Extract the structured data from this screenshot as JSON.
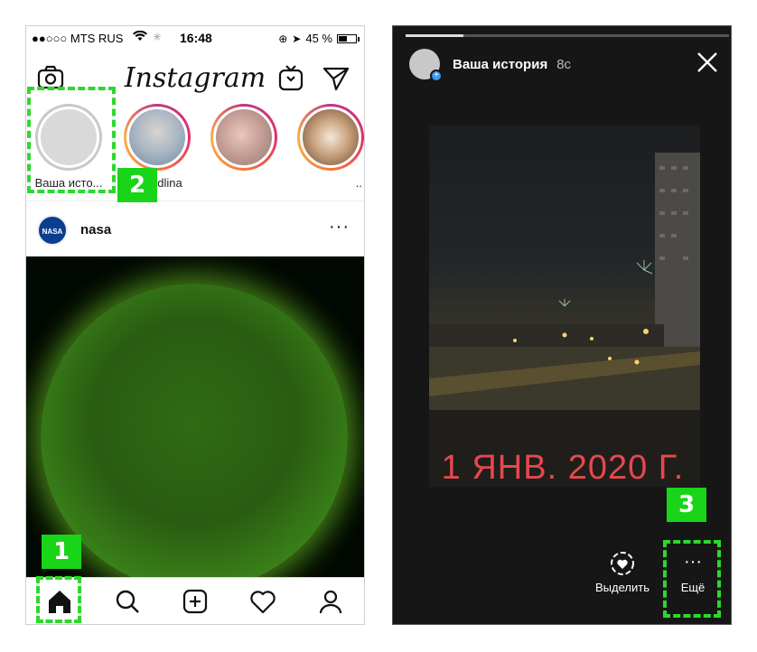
{
  "left_phone": {
    "status": {
      "carrier": "●●○○○ MTS RUS",
      "time": "16:48",
      "battery": "45 %"
    },
    "header": {
      "logo": "Instagram",
      "icons": [
        "camera-icon",
        "igtv-icon",
        "direct-icon"
      ]
    },
    "stories": [
      {
        "label": "Ваша исто...",
        "own": true
      },
      {
        "label": "dlina",
        "own": false
      },
      {
        "label": "",
        "own": false
      },
      {
        "label": "..",
        "own": false
      }
    ],
    "post": {
      "username": "nasa",
      "avatar_text": "NASA",
      "more": "···"
    },
    "tabs": [
      "home-icon",
      "search-icon",
      "add-post-icon",
      "activity-heart-icon",
      "profile-icon"
    ]
  },
  "right_phone": {
    "story_title": "Ваша история",
    "story_time": "8c",
    "progress": 0.18,
    "date_text": "1 ЯНВ. 2020 Г.",
    "actions": {
      "highlight_label": "Выделить",
      "more_label": "Ещё",
      "more_glyph": "···"
    }
  },
  "markers": {
    "one": "1",
    "two": "2",
    "three": "3"
  },
  "colors": {
    "marker_green": "#19d419",
    "story_date_red": "#e8474e",
    "story_ring_start": "#c13584",
    "story_ring_end": "#fcaf45"
  }
}
